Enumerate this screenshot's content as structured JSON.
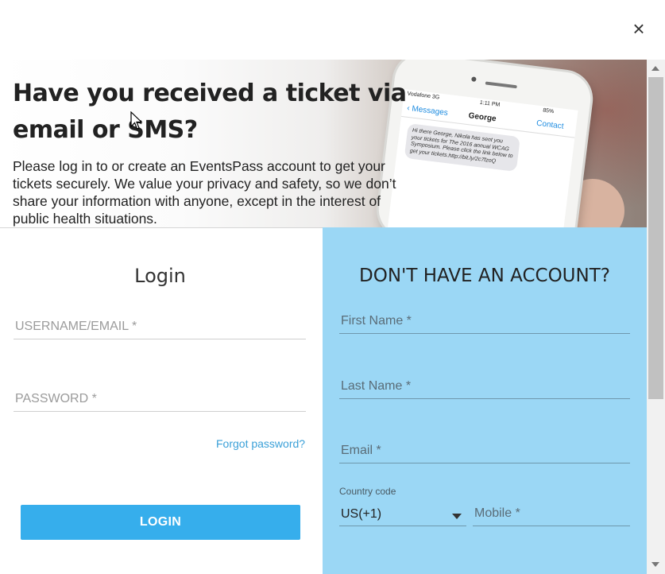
{
  "dialog": {
    "close_label": "×"
  },
  "hero": {
    "title_line1": "Have you received a ticket via",
    "title_line2": "email or SMS?",
    "description": "Please log in to or create an EventsPass account to get your tickets securely. We value your privacy and safety, so we don’t share your information with anyone, except in the interest of public health situations."
  },
  "phone_image": {
    "carrier": "Vodafone 3G",
    "time": "1:11 PM",
    "battery": "85%",
    "back_label": "Messages",
    "contact_name": "George",
    "contact_button": "Contact",
    "message": "Hi there George, Nikola has sent you your tickets for The 2016 annual WCAG Symposium. Please click the link below to get your tickets.http://bit.ly/2c7fzoQ"
  },
  "login": {
    "title": "Login",
    "username_placeholder": "USERNAME/EMAIL *",
    "password_placeholder": "PASSWORD *",
    "forgot_label": "Forgot password?",
    "button_label": "LOGIN"
  },
  "register": {
    "title": "DON'T HAVE AN ACCOUNT?",
    "first_name_placeholder": "First Name *",
    "last_name_placeholder": "Last Name *",
    "email_placeholder": "Email *",
    "country_code_label": "Country code",
    "country_code_value": "US(+1)",
    "mobile_placeholder": "Mobile *"
  },
  "colors": {
    "register_bg": "#9bd7f5",
    "button_bg": "#36aeec",
    "link": "#3aa0d8"
  }
}
